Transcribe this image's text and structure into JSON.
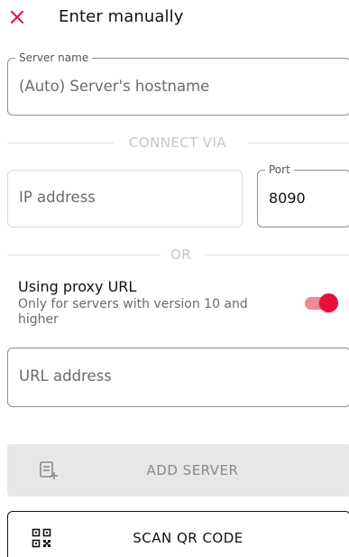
{
  "header": {
    "title": "Enter manually"
  },
  "server_name": {
    "label": "Server name",
    "placeholder": "(Auto) Server's hostname"
  },
  "connect_via": {
    "label": "CONNECT VIA"
  },
  "ip_address": {
    "placeholder": "IP address"
  },
  "port": {
    "label": "Port",
    "value": "8090"
  },
  "or_divider": {
    "label": "OR"
  },
  "proxy": {
    "title": "Using proxy URL",
    "description": "Only for servers with version 10 and higher",
    "enabled": true
  },
  "url_address": {
    "placeholder": "URL address"
  },
  "buttons": {
    "add_server": "ADD SERVER",
    "scan_qr": "SCAN QR CODE"
  },
  "colors": {
    "accent": "#e5113a",
    "accent_light": "#ec8a98"
  },
  "icons": {
    "close": "close-icon",
    "add_server": "add-server-icon",
    "qr": "qr-code-icon"
  }
}
